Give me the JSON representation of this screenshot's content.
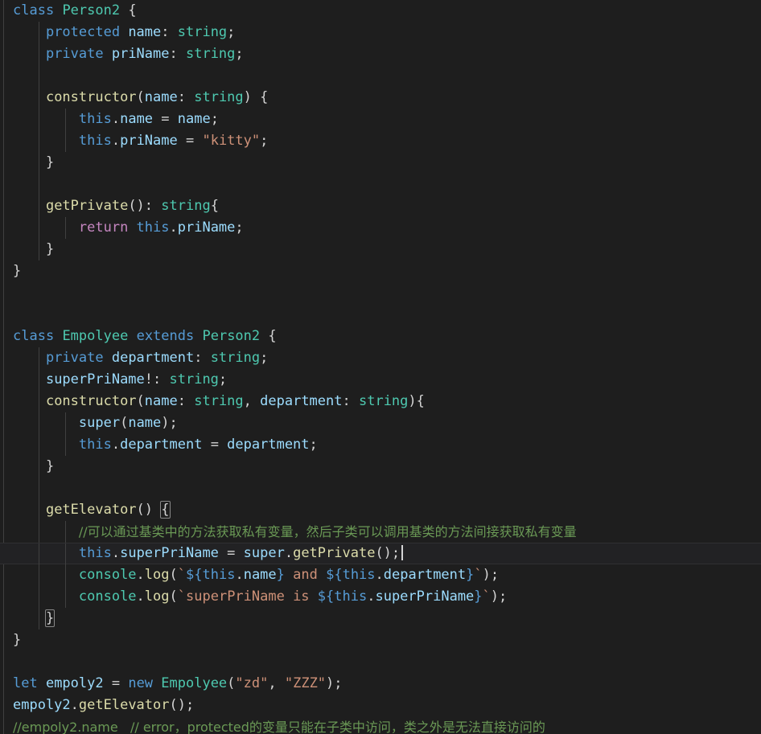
{
  "editor": {
    "background": "#1E1E1E",
    "foreground": "#D4D4D4",
    "current_line_background": "#222224",
    "language": "TypeScript",
    "cursor_line_index": 24,
    "colors": {
      "keyword": "#569CD6",
      "type": "#4EC9B0",
      "property": "#9CDCFE",
      "function": "#DCDCAA",
      "string": "#CE9178",
      "control": "#C586C0",
      "comment": "#6A9955",
      "punctuation": "#D4D4D4",
      "indent_guide": "#404040"
    }
  },
  "code": {
    "l1_class": "class",
    "l1_name": "Person2",
    "l1_brace": " {",
    "l2_kw": "protected",
    "l2_prop": " name",
    "l2_colon": ": ",
    "l2_type": "string",
    "l2_semi": ";",
    "l3_kw": "private",
    "l3_prop": " priName",
    "l3_colon": ": ",
    "l3_type": "string",
    "l3_semi": ";",
    "l5_fn": "constructor",
    "l5_paren": "(",
    "l5_prop": "name",
    "l5_colon": ": ",
    "l5_type": "string",
    "l5_close": ") {",
    "l6_this": "this",
    "l6_dot": ".",
    "l6_prop": "name",
    "l6_eq": " = ",
    "l6_val": "name",
    "l6_semi": ";",
    "l7_this": "this",
    "l7_dot": ".",
    "l7_prop": "priName",
    "l7_eq": " = ",
    "l7_str": "\"kitty\"",
    "l7_semi": ";",
    "l8_brace": "}",
    "l10_fn": "getPrivate",
    "l10_paren": "(): ",
    "l10_type": "string",
    "l10_brace": "{",
    "l11_ctrl": "return",
    "l11_this": " this",
    "l11_dot": ".",
    "l11_prop": "priName",
    "l11_semi": ";",
    "l12_brace": "}",
    "l13_brace": "}",
    "l16_class": "class",
    "l16_name": "Empolyee",
    "l16_extends": "extends",
    "l16_base": "Person2",
    "l16_brace": " {",
    "l17_kw": "private",
    "l17_prop": " department",
    "l17_colon": ": ",
    "l17_type": "string",
    "l17_semi": ";",
    "l18_prop": "superPriName",
    "l18_bang": "!: ",
    "l18_type": "string",
    "l18_semi": ";",
    "l19_fn": "constructor",
    "l19_p1": "(",
    "l19_a1": "name",
    "l19_c1": ": ",
    "l19_t1": "string",
    "l19_comma": ", ",
    "l19_a2": "department",
    "l19_c2": ": ",
    "l19_t2": "string",
    "l19_close": "){",
    "l20_super": "super",
    "l20_paren": "(",
    "l20_arg": "name",
    "l20_close": ");",
    "l21_this": "this",
    "l21_dot": ".",
    "l21_prop": "department",
    "l21_eq": " = ",
    "l21_val": "department",
    "l21_semi": ";",
    "l22_brace": "}",
    "l24_fn": "getElevator",
    "l24_paren": "() ",
    "l24_brace": "{",
    "l25_comment": "//可以通过基类中的方法获取私有变量，然后子类可以调用基类的方法间接获取私有变量",
    "l26_this": "this",
    "l26_dot": ".",
    "l26_prop": "superPriName",
    "l26_eq": " = ",
    "l26_super": "super",
    "l26_dot2": ".",
    "l26_fn": "getPrivate",
    "l26_close": "();",
    "l27_console": "console",
    "l27_dot": ".",
    "l27_log": "log",
    "l27_open": "(",
    "l27_tick1": "`",
    "l27_tpl1": "${",
    "l27_this1": "this",
    "l27_d1": ".",
    "l27_p1": "name",
    "l27_tpl1c": "}",
    "l27_mid": " and ",
    "l27_tpl2": "${",
    "l27_this2": "this",
    "l27_d2": ".",
    "l27_p2": "department",
    "l27_tpl2c": "}",
    "l27_tick2": "`",
    "l27_close": ");",
    "l28_console": "console",
    "l28_dot": ".",
    "l28_log": "log",
    "l28_open": "(",
    "l28_tick1": "`",
    "l28_text": "superPriName is ",
    "l28_tpl": "${",
    "l28_this": "this",
    "l28_d": ".",
    "l28_p": "superPriName",
    "l28_tplc": "}",
    "l28_tick2": "`",
    "l28_close": ");",
    "l29_brace": "}",
    "l30_brace": "}",
    "l32_let": "let",
    "l32_var": " empoly2",
    "l32_eq": " = ",
    "l32_new": "new",
    "l32_cls": " Empolyee",
    "l32_open": "(",
    "l32_s1": "\"zd\"",
    "l32_comma": ", ",
    "l32_s2": "\"ZZZ\"",
    "l32_close": ");",
    "l33_var": "empoly2",
    "l33_dot": ".",
    "l33_fn": "getElevator",
    "l33_close": "();",
    "l34_comment": "//empoly2.name   // error，protected的变量只能在子类中访问，类之外是无法直接访问的"
  }
}
